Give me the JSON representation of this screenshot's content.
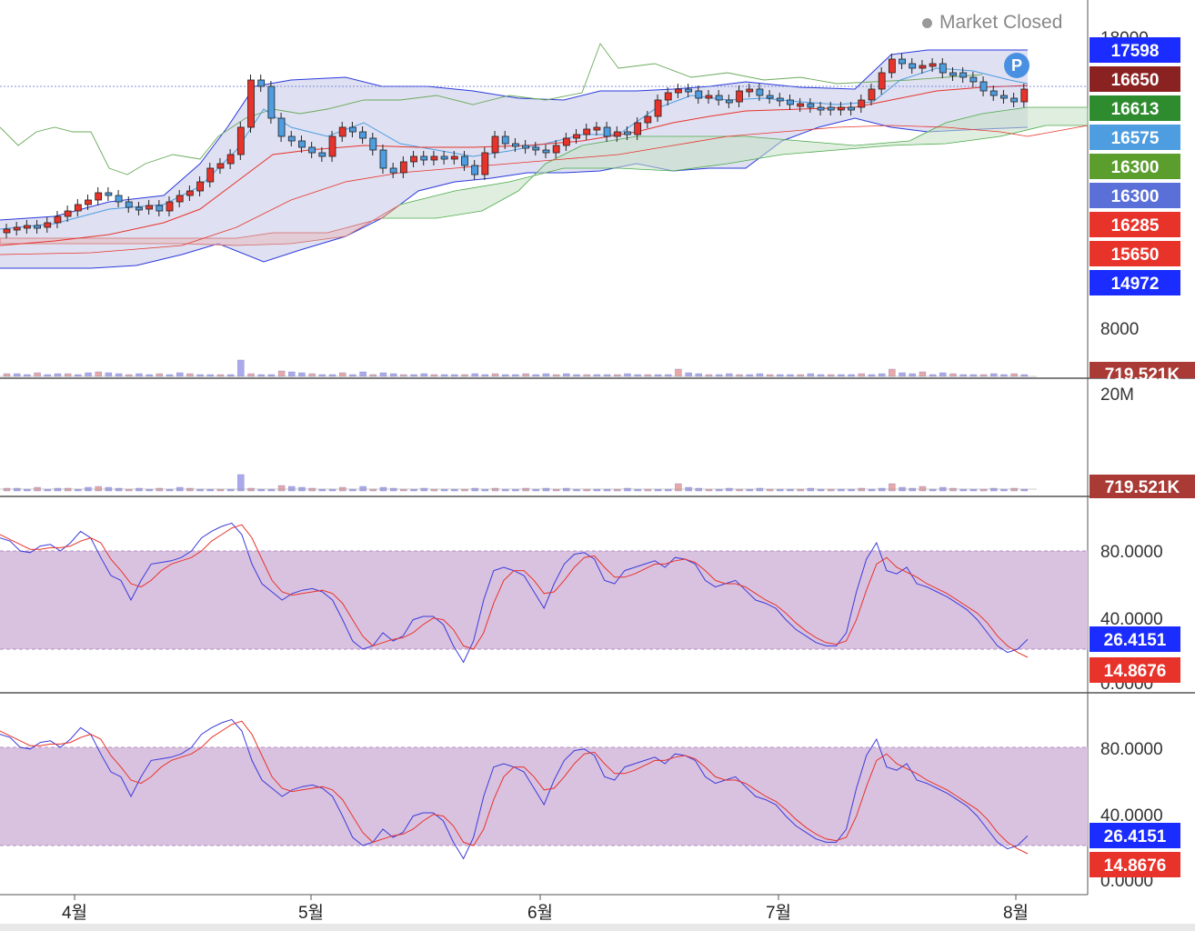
{
  "status": {
    "label": "Market Closed",
    "dot_color": "#999999"
  },
  "badge": {
    "label": "P",
    "color": "#4a90e2"
  },
  "chart_data": {
    "type": "candlestick",
    "x_labels": [
      "4월",
      "5월",
      "6월",
      "7월",
      "8월"
    ],
    "price_axis": {
      "ticks": [
        "18000",
        "8000"
      ],
      "tags": [
        {
          "value": "17598",
          "color": "#1a2cff"
        },
        {
          "value": "16650",
          "color": "#8b2222"
        },
        {
          "value": "16613",
          "color": "#2e8b2e"
        },
        {
          "value": "16575",
          "color": "#4d9de0"
        },
        {
          "value": "16300",
          "color": "#5c9e2e"
        },
        {
          "value": "16300",
          "color": "#5b6fd9"
        },
        {
          "value": "16285",
          "color": "#e8332b"
        },
        {
          "value": "15650",
          "color": "#e8332b"
        },
        {
          "value": "14972",
          "color": "#1a2cff"
        }
      ],
      "volume_tag": {
        "value": "719.521K",
        "color": "#a93a35"
      }
    },
    "volume_panel": {
      "tick": "20M",
      "tag": {
        "value": "719.521K",
        "color": "#a93a35"
      }
    },
    "stochastic_panels": [
      {
        "ticks": [
          "80.0000",
          "40.0000",
          "0.0000"
        ],
        "tags": [
          {
            "value": "26.4151",
            "color": "#1a2cff"
          },
          {
            "value": "14.8676",
            "color": "#e8332b"
          }
        ],
        "upper_band": 80,
        "lower_band": 20
      },
      {
        "ticks": [
          "80.0000",
          "40.0000",
          "0.0000"
        ],
        "tags": [
          {
            "value": "26.4151",
            "color": "#1a2cff"
          },
          {
            "value": "14.8676",
            "color": "#e8332b"
          }
        ],
        "upper_band": 80,
        "lower_band": 20
      }
    ],
    "stoch_k": [
      88,
      86,
      80,
      79,
      83,
      84,
      80,
      85,
      92,
      88,
      76,
      65,
      62,
      50,
      62,
      72,
      73,
      74,
      76,
      80,
      88,
      92,
      95,
      97,
      90,
      72,
      60,
      55,
      50,
      54,
      56,
      57,
      55,
      50,
      38,
      25,
      20,
      22,
      30,
      25,
      28,
      38,
      40,
      40,
      35,
      22,
      12,
      25,
      50,
      68,
      70,
      68,
      65,
      55,
      45,
      60,
      72,
      78,
      79,
      75,
      62,
      60,
      68,
      70,
      72,
      74,
      70,
      76,
      75,
      72,
      62,
      58,
      60,
      62,
      56,
      50,
      48,
      45,
      38,
      32,
      28,
      24,
      22,
      22,
      30,
      55,
      75,
      85,
      68,
      66,
      70,
      60,
      58,
      55,
      52,
      48,
      44,
      38,
      30,
      22,
      18,
      20,
      26
    ],
    "stoch_d": [
      90,
      87,
      84,
      81,
      81,
      82,
      82,
      83,
      86,
      88,
      85,
      75,
      68,
      60,
      58,
      62,
      68,
      72,
      74,
      76,
      80,
      86,
      90,
      94,
      96,
      88,
      75,
      62,
      55,
      53,
      54,
      55,
      56,
      54,
      48,
      38,
      28,
      22,
      24,
      26,
      27,
      30,
      35,
      39,
      38,
      32,
      22,
      20,
      30,
      48,
      62,
      68,
      68,
      62,
      54,
      55,
      62,
      70,
      76,
      77,
      70,
      64,
      64,
      66,
      69,
      72,
      72,
      74,
      75,
      73,
      68,
      62,
      60,
      60,
      58,
      54,
      50,
      47,
      42,
      36,
      31,
      27,
      24,
      23,
      25,
      38,
      56,
      72,
      76,
      70,
      67,
      64,
      60,
      57,
      54,
      50,
      46,
      42,
      36,
      28,
      22,
      18,
      15
    ]
  }
}
